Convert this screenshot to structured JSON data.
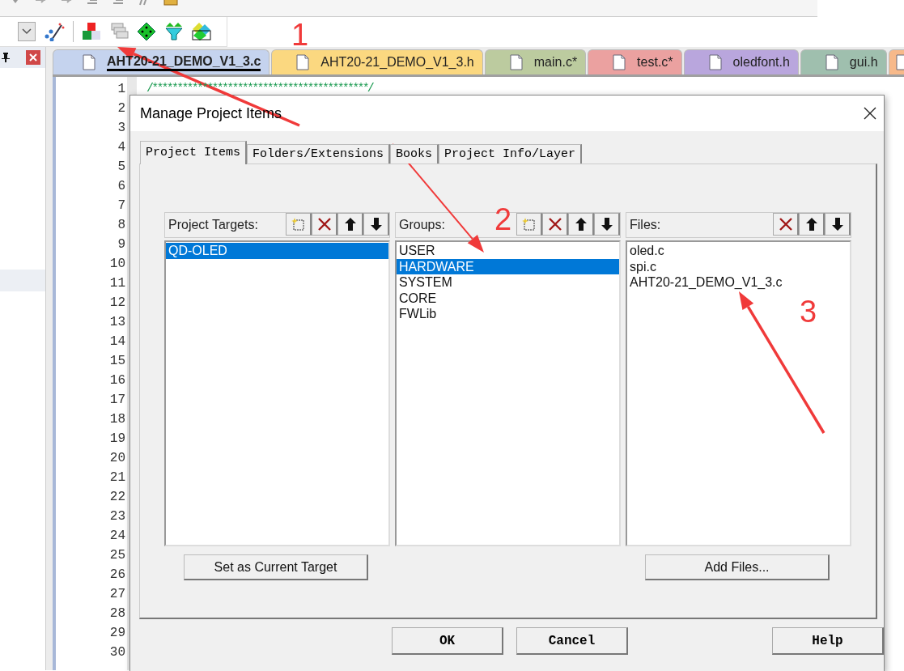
{
  "file_tabs": [
    {
      "label": "AHT20-21_DEMO_V1_3.c",
      "selected": true,
      "color": "#c5d3ee"
    },
    {
      "label": "AHT20-21_DEMO_V1_3.h",
      "selected": false,
      "color": "#fbd880"
    },
    {
      "label": "main.c*",
      "selected": false,
      "color": "#bccb9f"
    },
    {
      "label": "test.c*",
      "selected": false,
      "color": "#eba1a0"
    },
    {
      "label": "oledfont.h",
      "selected": false,
      "color": "#b9a6dd"
    },
    {
      "label": "gui.h",
      "selected": false,
      "color": "#9fbfae"
    },
    {
      "selected": false,
      "color": "#f7b98a"
    }
  ],
  "editor": {
    "line_numbers": [
      "1",
      "2",
      "3",
      "4",
      "5",
      "6",
      "7",
      "8",
      "9",
      "10",
      "11",
      "12",
      "13",
      "14",
      "15",
      "16",
      "17",
      "18",
      "19",
      "20",
      "21",
      "22",
      "23",
      "24",
      "25",
      "26",
      "27",
      "28",
      "29",
      "30"
    ],
    "lines": [
      "/*******************************************/"
    ]
  },
  "dialog": {
    "title": "Manage Project Items",
    "tabs": [
      {
        "label": "Project Items",
        "selected": true
      },
      {
        "label": "Folders/Extensions",
        "selected": false
      },
      {
        "label": "Books",
        "selected": false
      },
      {
        "label": "Project Info/Layer",
        "selected": false
      }
    ],
    "panels": [
      {
        "title": "Project Targets:",
        "new_button": true,
        "items": [
          {
            "text": "QD-OLED",
            "selected": true
          }
        ],
        "button": "Set as Current Target"
      },
      {
        "title": "Groups:",
        "new_button": true,
        "items": [
          {
            "text": "USER",
            "selected": false
          },
          {
            "text": "HARDWARE",
            "selected": true
          },
          {
            "text": "SYSTEM",
            "selected": false
          },
          {
            "text": "CORE",
            "selected": false
          },
          {
            "text": "FWLib",
            "selected": false
          }
        ]
      },
      {
        "title": "Files:",
        "new_button": false,
        "items": [
          {
            "text": "oled.c",
            "selected": false
          },
          {
            "text": "spi.c",
            "selected": false
          },
          {
            "text": "AHT20-21_DEMO_V1_3.c",
            "selected": false
          }
        ],
        "button": "Add Files..."
      }
    ],
    "buttons": [
      "OK",
      "Cancel",
      "Help"
    ]
  },
  "annotations": [
    {
      "label": "1"
    },
    {
      "label": "2"
    },
    {
      "label": "3"
    }
  ]
}
